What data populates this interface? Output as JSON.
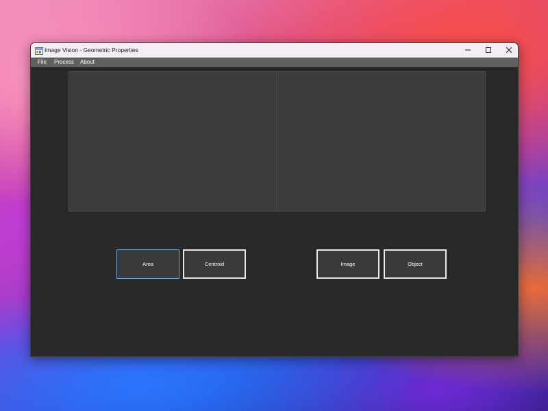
{
  "window": {
    "title": "Image Vision - Geometric Properties",
    "app_icon": "app-window-icon",
    "controls": {
      "minimize_icon": "minimize-icon",
      "maximize_icon": "maximize-icon",
      "close_icon": "close-icon"
    }
  },
  "menu": {
    "items": [
      {
        "label": "File"
      },
      {
        "label": "Process"
      },
      {
        "label": "About"
      }
    ]
  },
  "panels": {
    "left": {
      "content": ""
    },
    "right": {
      "content": ""
    }
  },
  "buttons": {
    "area": "Area",
    "centroid": "Centroid",
    "image": "Image",
    "object": "Object"
  },
  "colors": {
    "window_bg": "#282828",
    "panel_bg": "#3c3c3c",
    "menubar_bg": "#606060",
    "titlebar_bg": "#f3eef3",
    "focus_border": "#6aa8e0"
  }
}
